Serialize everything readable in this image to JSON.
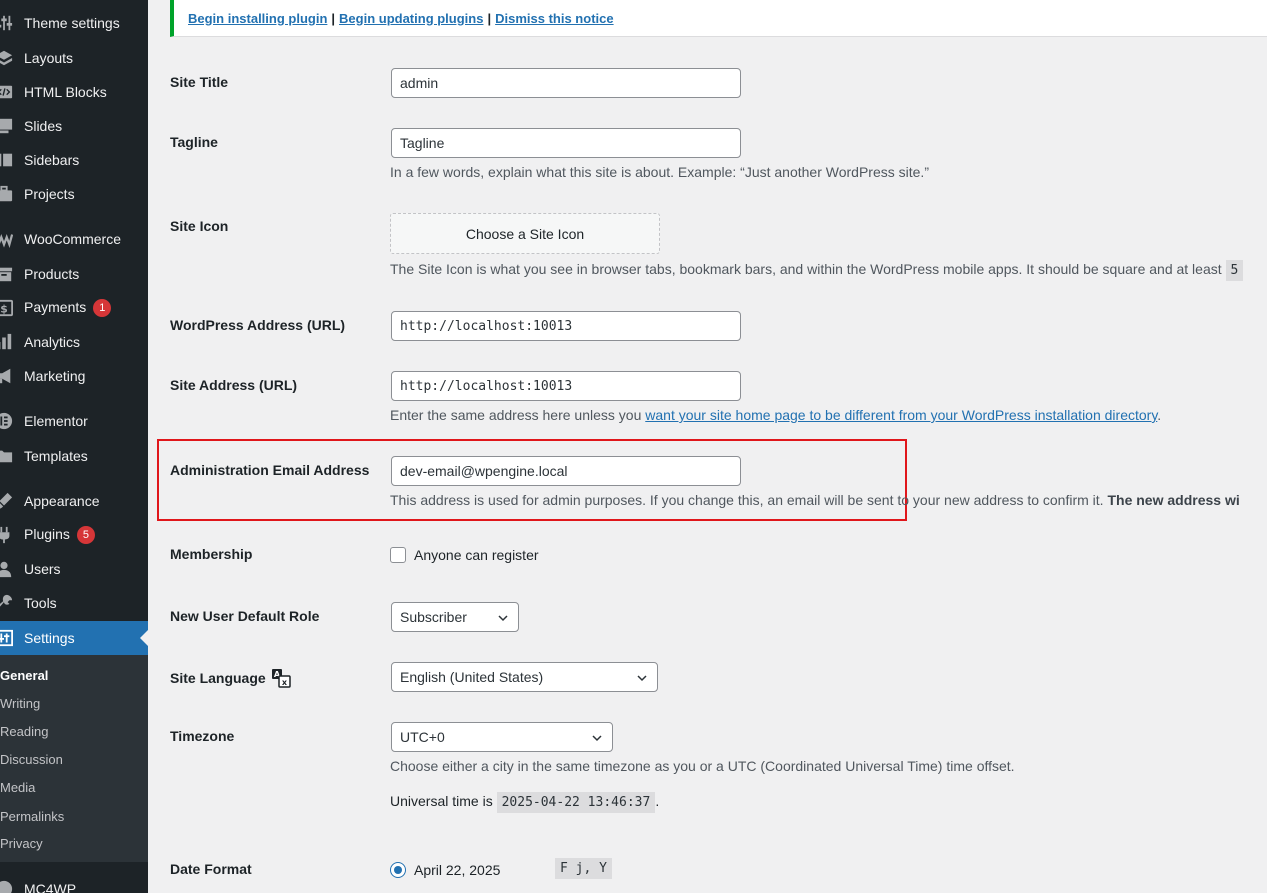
{
  "sidebar": {
    "items": [
      {
        "label": "Theme settings",
        "icon": "sliders-icon"
      },
      {
        "label": "Layouts",
        "icon": "layers-icon"
      },
      {
        "label": "HTML Blocks",
        "icon": "code-block-icon"
      },
      {
        "label": "Slides",
        "icon": "slides-icon"
      },
      {
        "label": "Sidebars",
        "icon": "sidebar-icon"
      },
      {
        "label": "Projects",
        "icon": "briefcase-icon"
      },
      {
        "label": "WooCommerce",
        "icon": "woocommerce-icon"
      },
      {
        "label": "Products",
        "icon": "archive-icon"
      },
      {
        "label": "Payments",
        "icon": "dollar-icon",
        "badge": "1"
      },
      {
        "label": "Analytics",
        "icon": "bar-chart-icon"
      },
      {
        "label": "Marketing",
        "icon": "megaphone-icon"
      },
      {
        "label": "Elementor",
        "icon": "elementor-icon"
      },
      {
        "label": "Templates",
        "icon": "folder-icon"
      },
      {
        "label": "Appearance",
        "icon": "paintbrush-icon"
      },
      {
        "label": "Plugins",
        "icon": "plug-icon",
        "badge": "5"
      },
      {
        "label": "Users",
        "icon": "user-icon"
      },
      {
        "label": "Tools",
        "icon": "wrench-icon"
      },
      {
        "label": "Settings",
        "icon": "settings-icon",
        "active": true
      },
      {
        "label": "MC4WP",
        "icon": "mc4wp-icon"
      }
    ],
    "submenu": [
      "General",
      "Writing",
      "Reading",
      "Discussion",
      "Media",
      "Permalinks",
      "Privacy"
    ],
    "accent_color": "#2271b1"
  },
  "notice": {
    "link_install": "Begin installing plugin",
    "link_update": "Begin updating plugins",
    "link_dismiss": "Dismiss this notice",
    "separator": "|"
  },
  "form": {
    "site_title": {
      "label": "Site Title",
      "value": "admin"
    },
    "tagline": {
      "label": "Tagline",
      "value": "Tagline",
      "description": "In a few words, explain what this site is about. Example: “Just another WordPress site.”"
    },
    "site_icon": {
      "label": "Site Icon",
      "button": "Choose a Site Icon",
      "description": "The Site Icon is what you see in browser tabs, bookmark bars, and within the WordPress mobile apps. It should be square and at least",
      "code_fragment": "5"
    },
    "wp_address": {
      "label": "WordPress Address (URL)",
      "value": "http://localhost:10013"
    },
    "site_address": {
      "label": "Site Address (URL)",
      "value": "http://localhost:10013",
      "description_before": "Enter the same address here unless you",
      "description_link": "want your site home page to be different from your WordPress installation directory",
      "description_after": "."
    },
    "admin_email": {
      "label": "Administration Email Address",
      "value": "dev-email@wpengine.local",
      "description": "This address is used for admin purposes. If you change this, an email will be sent to your new address to confirm it.",
      "description_strong": "The new address wi"
    },
    "membership": {
      "label": "Membership",
      "checkbox_label": "Anyone can register",
      "checked": false
    },
    "default_role": {
      "label": "New User Default Role",
      "value": "Subscriber"
    },
    "site_language": {
      "label": "Site Language",
      "value": "English (United States)",
      "icon": "translation-icon"
    },
    "timezone": {
      "label": "Timezone",
      "value": "UTC+0",
      "description": "Choose either a city in the same timezone as you or a UTC (Coordinated Universal Time) time offset.",
      "universal_label": "Universal time is",
      "universal_value": "2025-04-22 13:46:37",
      "universal_after": "."
    },
    "date_format": {
      "label": "Date Format",
      "option_label": "April 22, 2025",
      "option_code": "F j, Y",
      "selected": true
    }
  },
  "highlight_color": "#e0161b"
}
